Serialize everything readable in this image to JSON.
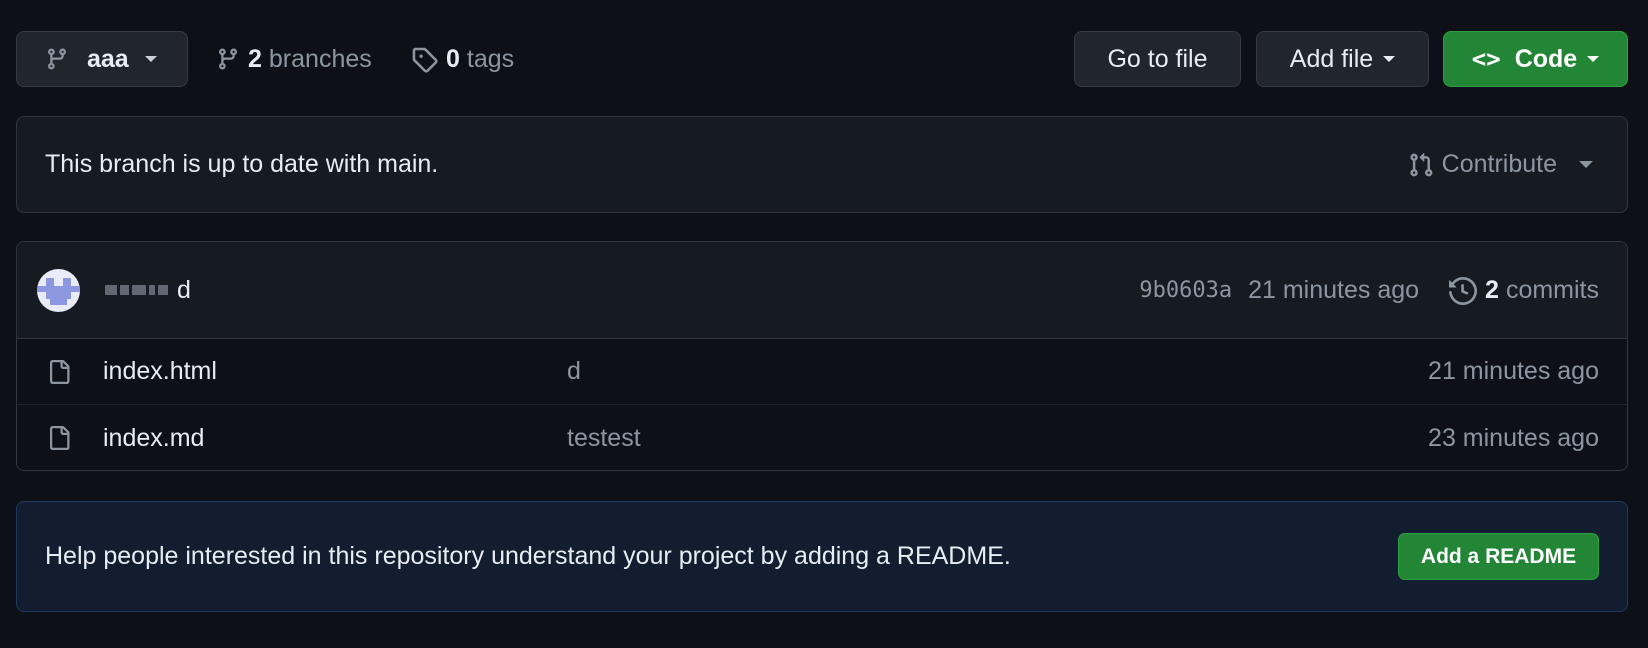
{
  "toolbar": {
    "branch_name": "aaa",
    "branches_count": "2",
    "branches_label": "branches",
    "tags_count": "0",
    "tags_label": "tags",
    "goto_file_label": "Go to file",
    "add_file_label": "Add file",
    "code_label": "Code",
    "code_glyph": "<>"
  },
  "status": {
    "message": "This branch is up to date with main.",
    "contribute_label": "Contribute"
  },
  "latest_commit": {
    "message": "d",
    "sha": "9b0603a",
    "time": "21 minutes ago",
    "commits_count": "2",
    "commits_label": "commits"
  },
  "files": [
    {
      "name": "index.html",
      "message": "d",
      "age": "21 minutes ago",
      "icon": "file-icon"
    },
    {
      "name": "index.md",
      "message": "testest",
      "age": "23 minutes ago",
      "icon": "file-icon"
    }
  ],
  "readme": {
    "message": "Help people interested in this repository understand your project by adding a README.",
    "button_label": "Add a README"
  },
  "colors": {
    "background": "#0d1117",
    "surface": "#161b22",
    "border": "#30363d",
    "primary_green": "#238636",
    "muted_text": "#8d96a0",
    "info_bg": "#121d2f"
  }
}
